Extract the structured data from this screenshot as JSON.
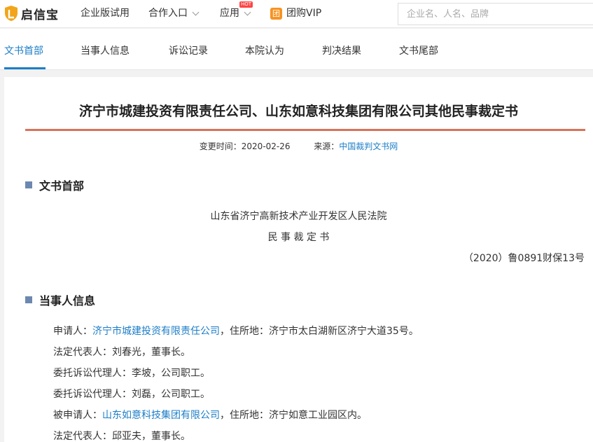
{
  "header": {
    "logo_text": "启信宝",
    "nav": [
      {
        "label": "企业版试用"
      },
      {
        "label": "合作入口"
      },
      {
        "label": "应用",
        "badge": "HOT"
      },
      {
        "label": "团购VIP",
        "icon_char": "团"
      }
    ],
    "search_placeholder": "企业名、人名、品牌"
  },
  "tabs": [
    "文书首部",
    "当事人信息",
    "诉讼记录",
    "本院认为",
    "判决结果",
    "文书尾部"
  ],
  "document": {
    "title": "济宁市城建投资有限责任公司、山东如意科技集团有限公司其他民事裁定书",
    "meta": {
      "changed_label": "变更时间：",
      "changed_value": "2020-02-26",
      "source_label": "来源：",
      "source_value": "中国裁判文书网"
    },
    "head_section": {
      "heading": "文书首部",
      "court": "山东省济宁高新技术产业开发区人民法院",
      "doc_type": "民 事 裁 定 书",
      "case_no": "（2020）鲁0891财保13号"
    },
    "parties_section": {
      "heading": "当事人信息",
      "lines": [
        {
          "prefix": "申请人：",
          "link": "济宁市城建投资有限责任公司",
          "suffix": "，住所地：济宁市太白湖新区济宁大道35号。"
        },
        {
          "prefix": "法定代表人：刘春光，董事长。",
          "link": "",
          "suffix": ""
        },
        {
          "prefix": "委托诉讼代理人：李坡，公司职工。",
          "link": "",
          "suffix": ""
        },
        {
          "prefix": "委托诉讼代理人：刘磊，公司职工。",
          "link": "",
          "suffix": ""
        },
        {
          "prefix": "被申请人：",
          "link": "山东如意科技集团有限公司",
          "suffix": "，住所地：济宁如意工业园区内。"
        },
        {
          "prefix": "法定代表人：邱亚夫，董事长。",
          "link": "",
          "suffix": ""
        }
      ]
    }
  },
  "colors": {
    "accent_blue": "#1c7ec8",
    "title_rule": "#d9735a",
    "section_marker": "#6c88b0",
    "hot_badge": "#ff4444",
    "vip_orange": "#f79321"
  }
}
